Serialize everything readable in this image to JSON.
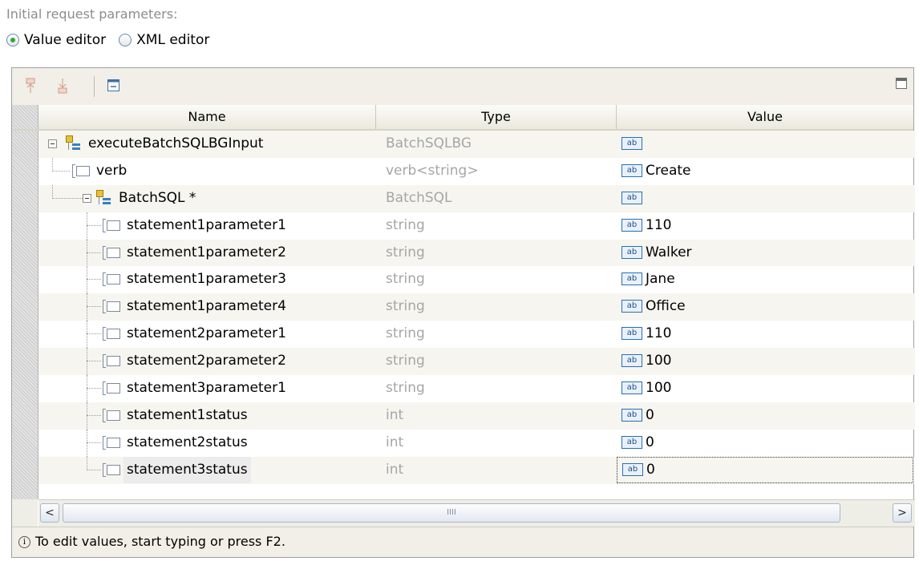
{
  "section_label": "Initial request parameters:",
  "editor_mode": {
    "options": [
      {
        "label": "Value editor",
        "selected": true
      },
      {
        "label": "XML editor",
        "selected": false
      }
    ]
  },
  "table": {
    "columns": [
      "Name",
      "Type",
      "Value"
    ],
    "rows": [
      {
        "name": "executeBatchSQLBGInput",
        "type": "BatchSQLBG",
        "value": ""
      },
      {
        "name": "verb",
        "type": "verb<string>",
        "value": "Create"
      },
      {
        "name": "BatchSQL *",
        "type": "BatchSQL",
        "value": ""
      },
      {
        "name": "statement1parameter1",
        "type": "string",
        "value": "110"
      },
      {
        "name": "statement1parameter2",
        "type": "string",
        "value": "Walker"
      },
      {
        "name": "statement1parameter3",
        "type": "string",
        "value": "Jane"
      },
      {
        "name": "statement1parameter4",
        "type": "string",
        "value": "Office"
      },
      {
        "name": "statement2parameter1",
        "type": "string",
        "value": "110"
      },
      {
        "name": "statement2parameter2",
        "type": "string",
        "value": "100"
      },
      {
        "name": "statement3parameter1",
        "type": "string",
        "value": "100"
      },
      {
        "name": "statement1status",
        "type": "int",
        "value": "0"
      },
      {
        "name": "statement2status",
        "type": "int",
        "value": "0"
      },
      {
        "name": "statement3status",
        "type": "int",
        "value": "0"
      }
    ]
  },
  "value_badge": "ab",
  "scroll": {
    "left": "<",
    "right": ">",
    "grip": "IIII"
  },
  "status": {
    "icon": "i",
    "text": "To edit values, start typing or press F2."
  },
  "colors": {
    "selected_radio": "#2da83c",
    "value_badge": "#2a6fb0",
    "type_text": "#a6a6a6"
  }
}
